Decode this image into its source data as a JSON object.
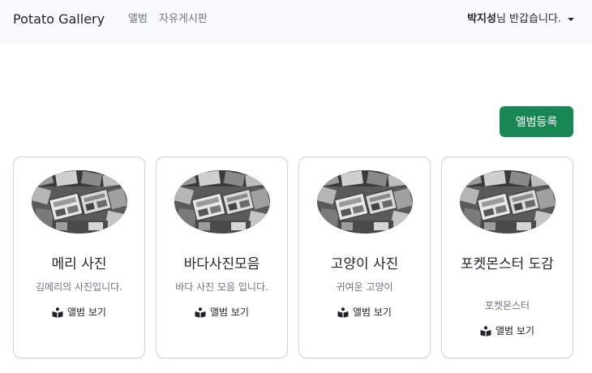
{
  "navbar": {
    "brand": "Potato Gallery",
    "links": [
      "앨범",
      "자유게시판"
    ],
    "user_name": "박지성",
    "user_greeting": "님 반갑습니다."
  },
  "actions": {
    "register_label": "앨범등록"
  },
  "colors": {
    "primary": "#198754",
    "navbar_bg": "#f8f9fa",
    "muted_text": "#6c757d"
  },
  "albums": [
    {
      "title": "메리 사진",
      "description": "김메리의 사진입니다.",
      "link_label": "앨범 보기",
      "icon": "book-reader-icon"
    },
    {
      "title": "바다사진모음",
      "description": "바다 사진 모음 입니다.",
      "link_label": "앨범 보기",
      "icon": "book-reader-icon"
    },
    {
      "title": "고양이 사진",
      "description": "귀여운 고양이",
      "link_label": "앨범 보기",
      "icon": "book-reader-icon"
    },
    {
      "title": "포켓몬스터 도감",
      "description": "포켓몬스터",
      "link_label": "앨범 보기",
      "icon": "book-reader-icon"
    }
  ]
}
